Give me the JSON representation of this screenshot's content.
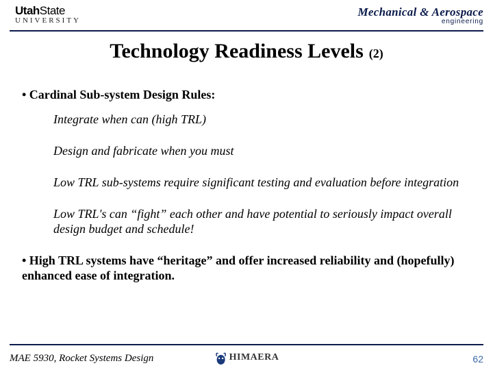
{
  "header": {
    "left_logo_bold": "UtahState",
    "left_logo_sub": "UNIVERSITY",
    "right_logo_dept": "Mechanical & Aerospace",
    "right_logo_sub": "engineering"
  },
  "title": {
    "main": "Technology Readiness Levels",
    "sub": "(2)"
  },
  "body": {
    "bullet1": "• Cardinal Sub-system Design Rules:",
    "subs": [
      "Integrate when can (high TRL)",
      "Design and fabricate when you must",
      "Low TRL sub-systems require significant testing and evaluation before integration",
      "Low TRL's can “fight” each other and have potential to seriously impact overall design budget and schedule!"
    ],
    "bullet2": "•  High TRL systems have “heritage” and offer increased reliability and (hopefully) enhanced ease of integration."
  },
  "footer": {
    "course": "MAE 5930, Rocket Systems Design",
    "center_logo": "HIMAERA",
    "page": "62"
  }
}
